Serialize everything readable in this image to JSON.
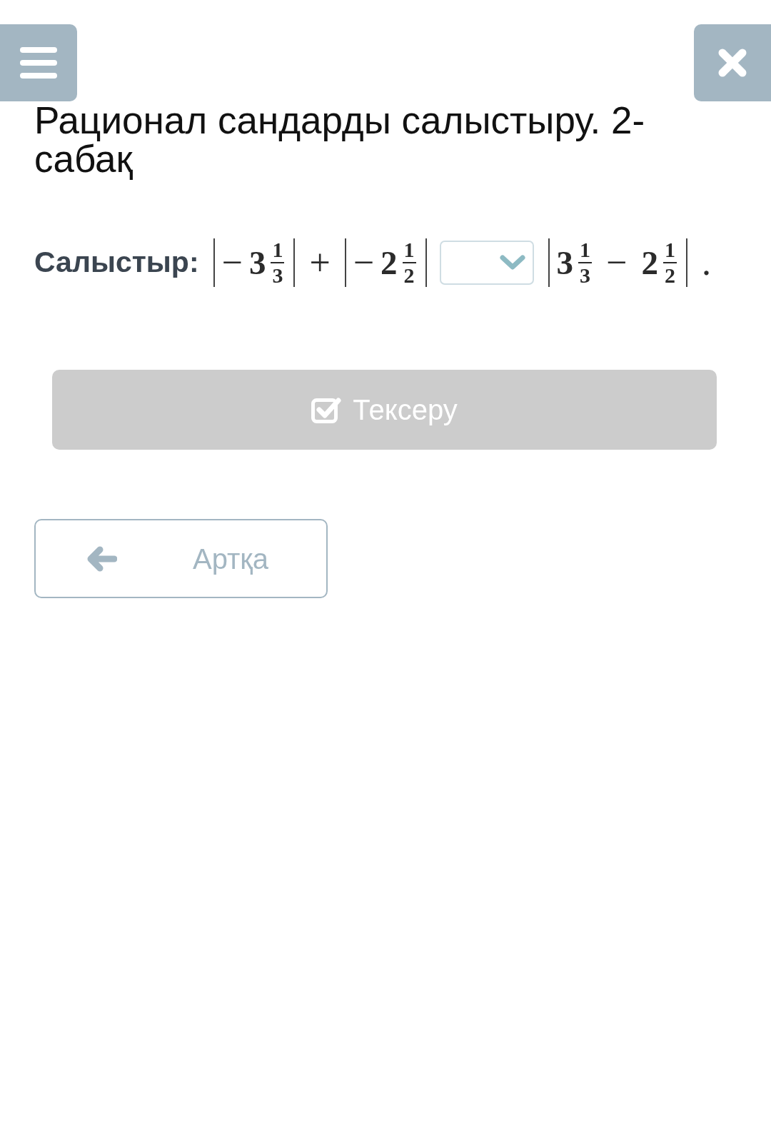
{
  "title": "Рационал сандарды салыстыру. 2-сабақ",
  "question": {
    "label": "Салыстыр:",
    "left": [
      {
        "kind": "abs",
        "items": [
          {
            "kind": "op",
            "text": "−"
          },
          {
            "kind": "mixed",
            "whole": "3",
            "num": "1",
            "den": "3"
          }
        ]
      },
      {
        "kind": "op",
        "text": "+"
      },
      {
        "kind": "abs",
        "items": [
          {
            "kind": "op",
            "text": "−"
          },
          {
            "kind": "mixed",
            "whole": "2",
            "num": "1",
            "den": "2"
          }
        ]
      }
    ],
    "answer": {
      "kind": "dropdown"
    },
    "right": [
      {
        "kind": "abs",
        "items": [
          {
            "kind": "mixed",
            "whole": "3",
            "num": "1",
            "den": "3"
          },
          {
            "kind": "op",
            "text": "−"
          },
          {
            "kind": "mixed",
            "whole": "2",
            "num": "1",
            "den": "2"
          }
        ]
      },
      {
        "kind": "op",
        "text": "."
      }
    ]
  },
  "check_button": {
    "label": "Тексеру",
    "disabled": true
  },
  "back_button": {
    "label": "Артқа"
  }
}
